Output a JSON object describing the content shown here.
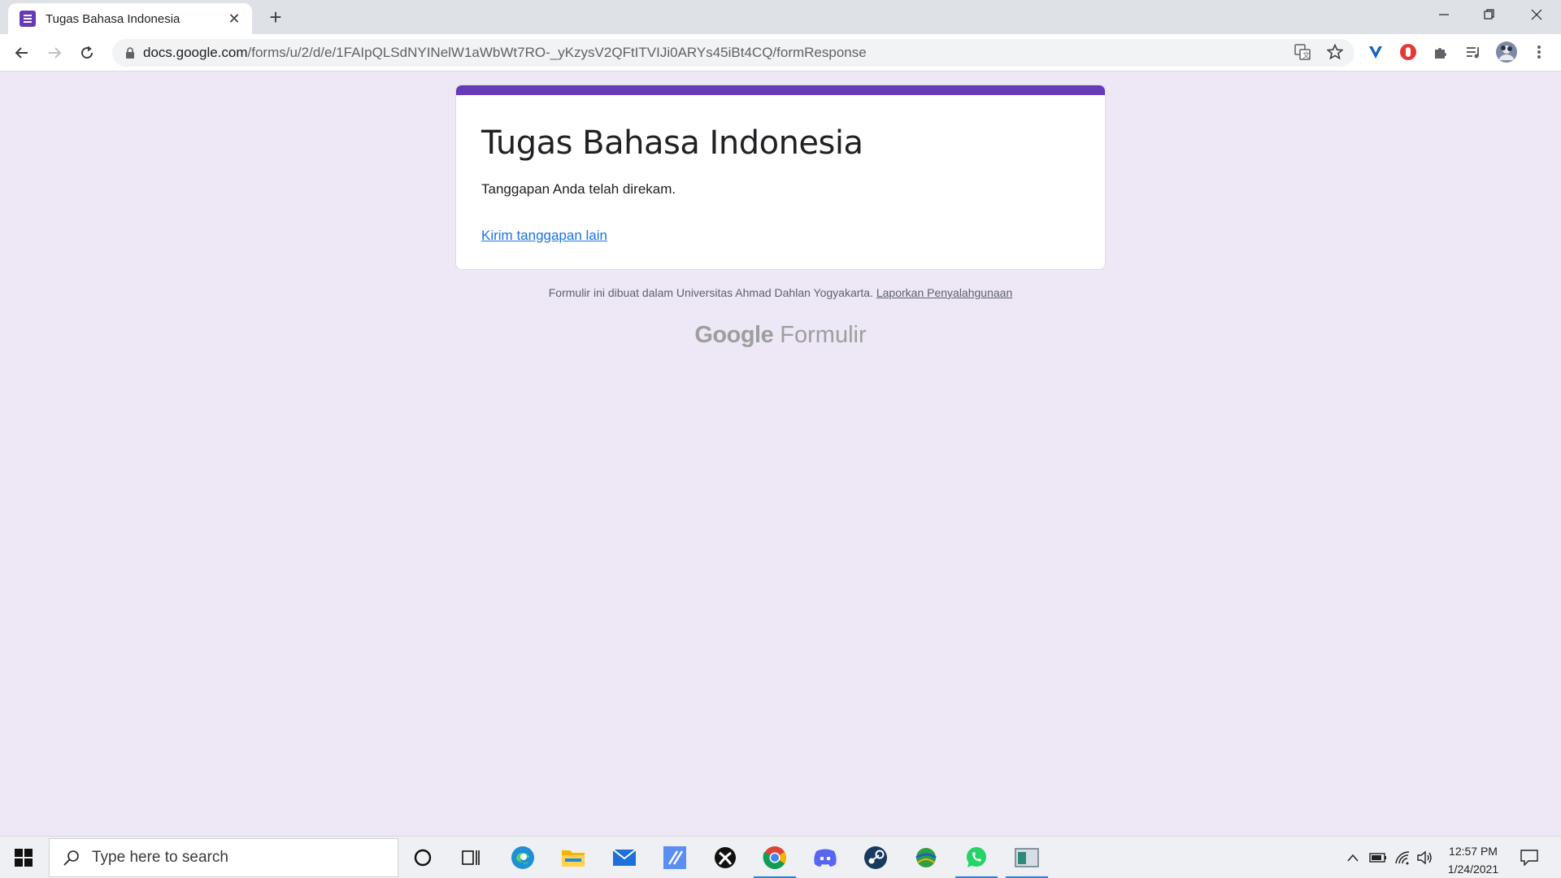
{
  "browser": {
    "tab_title": "Tugas Bahasa Indonesia",
    "url_host": "docs.google.com",
    "url_path": "/forms/u/2/d/e/1FAIpQLSdNYINelW1aWbWt7RO-_yKzysV2QFtITVIJi0ARYs45iBt4CQ/formResponse"
  },
  "form": {
    "title": "Tugas Bahasa Indonesia",
    "message": "Tanggapan Anda telah direkam.",
    "link": "Kirim tanggapan lain",
    "accent_color": "#673ab7"
  },
  "footer": {
    "note": "Formulir ini dibuat dalam Universitas Ahmad Dahlan Yogyakarta.",
    "report_link": "Laporkan Penyalahgunaan",
    "brand_google": "Google",
    "brand_product": "Formulir"
  },
  "taskbar": {
    "search_placeholder": "Type here to search",
    "time": "12:57 PM",
    "date": "1/24/2021",
    "apps": [
      "cortana-icon",
      "task-view-icon",
      "edge-icon",
      "file-explorer-icon",
      "mail-icon",
      "app-icon",
      "xbox-icon",
      "chrome-icon",
      "discord-icon",
      "steam-icon",
      "idm-icon",
      "whatsapp-icon",
      "window-app-icon"
    ]
  }
}
